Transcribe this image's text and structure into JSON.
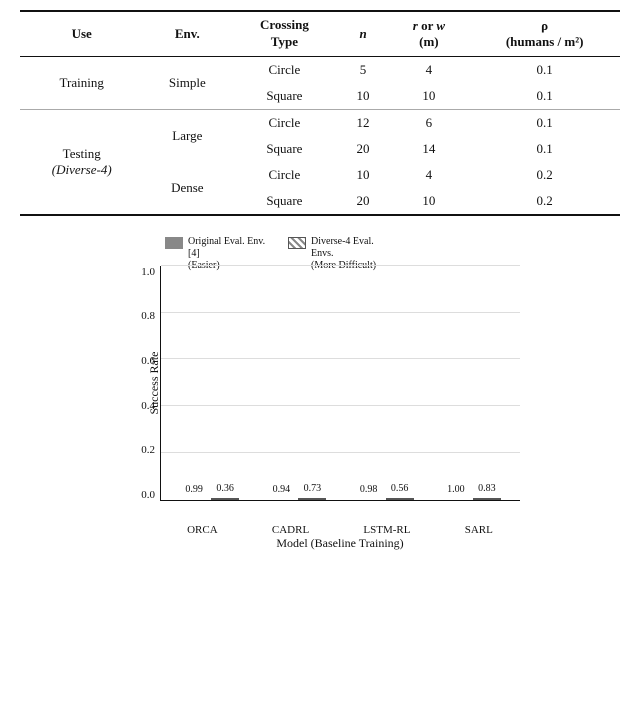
{
  "table": {
    "headers": [
      "Use",
      "Env.",
      "Crossing Type",
      "n",
      "r or w (m)",
      "ρ (humans / m²)"
    ],
    "rows": [
      {
        "use": "Training",
        "use_rowspan": 2,
        "env": "Simple",
        "env_rowspan": 2,
        "crossing": "Circle",
        "n": "5",
        "r_or_w": "4",
        "rho": "0.1"
      },
      {
        "use": "",
        "env": "",
        "crossing": "Square",
        "n": "10",
        "r_or_w": "10",
        "rho": "0.1"
      },
      {
        "use": "Testing",
        "use_sub": "(Diverse-4)",
        "use_rowspan": 4,
        "env": "Large",
        "env_rowspan": 2,
        "crossing": "Circle",
        "n": "12",
        "r_or_w": "6",
        "rho": "0.1"
      },
      {
        "use": "",
        "env": "",
        "crossing": "Square",
        "n": "20",
        "r_or_w": "14",
        "rho": "0.1"
      },
      {
        "use": "",
        "env": "Dense",
        "env_rowspan": 2,
        "crossing": "Circle",
        "n": "10",
        "r_or_w": "4",
        "rho": "0.2"
      },
      {
        "use": "",
        "env": "",
        "crossing": "Square",
        "n": "20",
        "r_or_w": "10",
        "rho": "0.2"
      }
    ]
  },
  "chart": {
    "title_y": "Success Rate",
    "title_x": "Model (Baseline Training)",
    "y_labels": [
      "1.0",
      "0.8",
      "0.6",
      "0.4",
      "0.2",
      "0.0"
    ],
    "legend": [
      {
        "label": "Original Eval. Env. [4]\n(Easier)",
        "type": "solid"
      },
      {
        "label": "Diverse-4 Eval. Envs.\n(More Difficult)",
        "type": "hatched"
      }
    ],
    "groups": [
      {
        "model": "ORCA",
        "solid_val": 0.99,
        "solid_label": "0.99",
        "hatched_val": 0.36,
        "hatched_label": "0.36"
      },
      {
        "model": "CADRL",
        "solid_val": 0.94,
        "solid_label": "0.94",
        "hatched_val": 0.73,
        "hatched_label": "0.73"
      },
      {
        "model": "LSTM-RL",
        "solid_val": 0.98,
        "solid_label": "0.98",
        "hatched_val": 0.56,
        "hatched_label": "0.56"
      },
      {
        "model": "SARL",
        "solid_val": 1.0,
        "solid_label": "1.00",
        "hatched_val": 0.83,
        "hatched_label": "0.83"
      }
    ]
  }
}
